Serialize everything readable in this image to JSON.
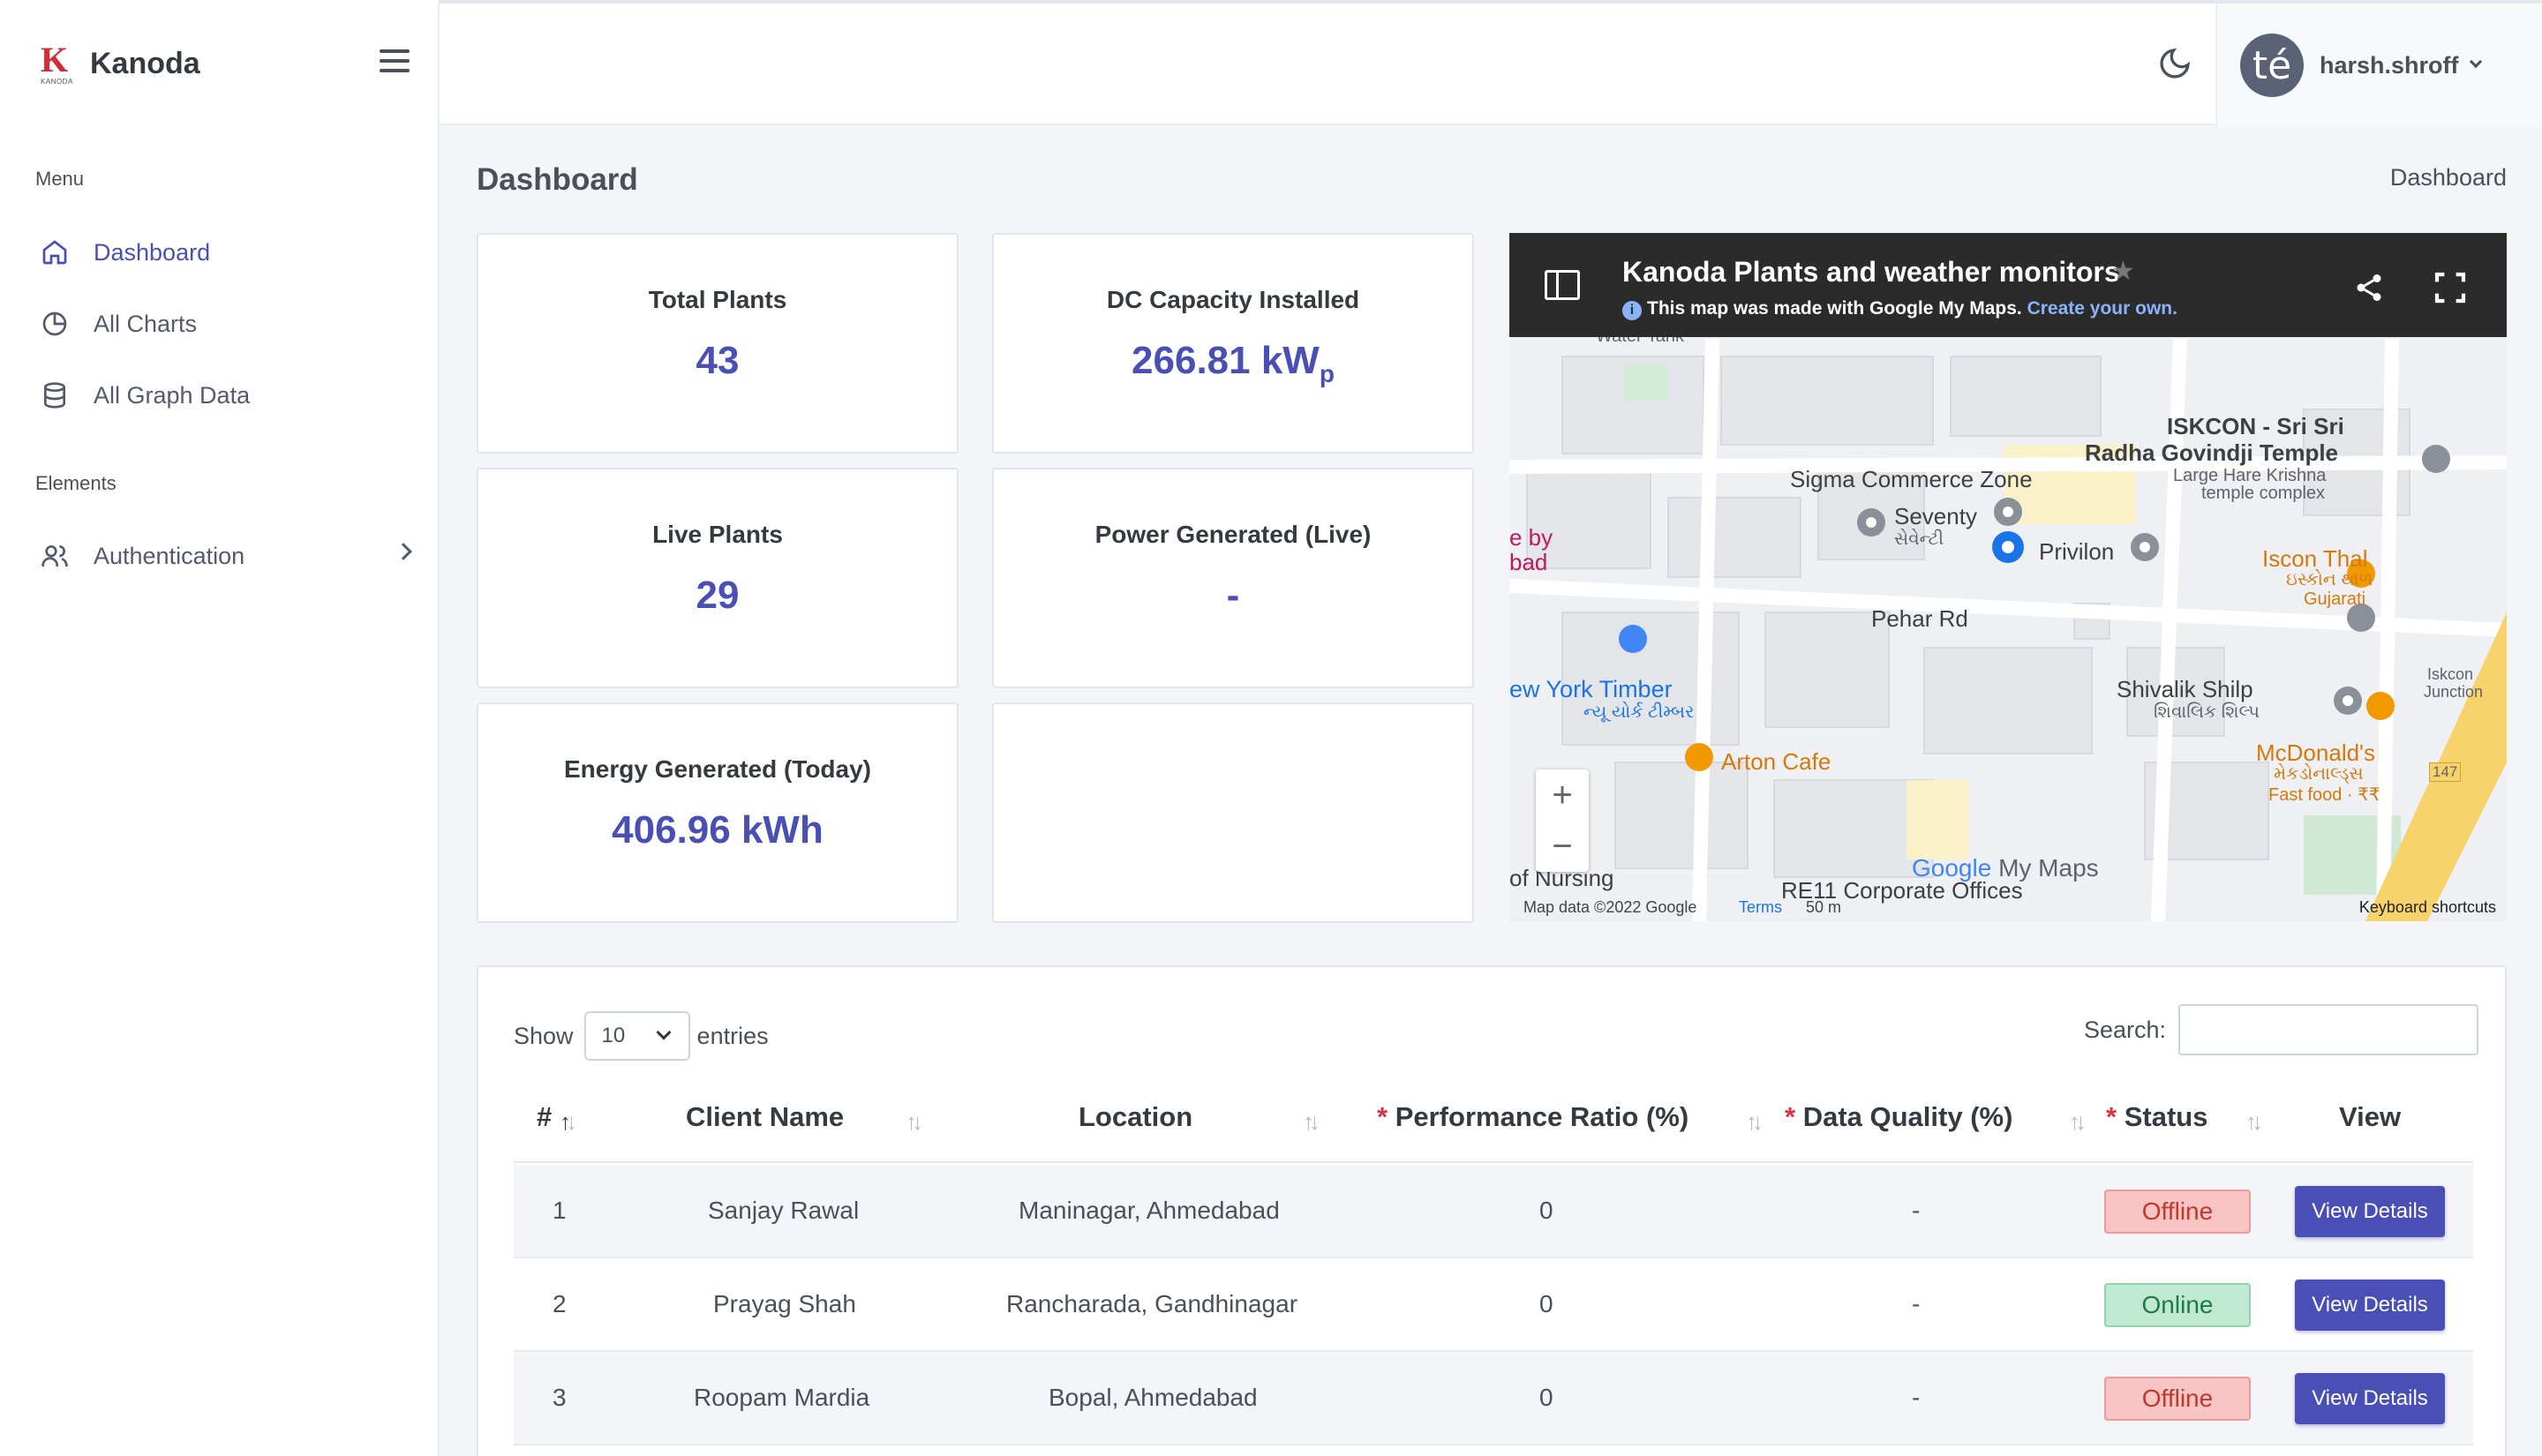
{
  "brand": {
    "name": "Kanoda",
    "logo_letter": "K",
    "logo_text": "KANODA"
  },
  "sidebar": {
    "menu_title": "Menu",
    "elements_title": "Elements",
    "items": [
      {
        "label": "Dashboard",
        "icon": "home-icon",
        "active": true
      },
      {
        "label": "All Charts",
        "icon": "pie-chart-icon"
      },
      {
        "label": "All Graph Data",
        "icon": "database-icon"
      }
    ],
    "elements": [
      {
        "label": "Authentication",
        "icon": "users-icon"
      }
    ]
  },
  "topbar": {
    "user_initials": "té",
    "user_name": "harsh.shroff",
    "theme_icon": "moon-icon"
  },
  "page": {
    "title": "Dashboard",
    "breadcrumb": "Dashboard"
  },
  "stats": {
    "total_plants": {
      "label": "Total Plants",
      "value": "43"
    },
    "dc_capacity": {
      "label": "DC Capacity Installed",
      "value": "266.81 kW",
      "unit_sub": "p"
    },
    "live_plants": {
      "label": "Live Plants",
      "value": "29"
    },
    "power_generated": {
      "label": "Power Generated (Live)",
      "value": "-"
    },
    "energy_today": {
      "label": "Energy Generated (Today)",
      "value": "406.96 kWh"
    }
  },
  "map": {
    "title": "Kanoda Plants and weather monitors",
    "subtitle": "This map was made with Google My Maps.",
    "subtitle_link": "Create your own.",
    "zoom_in": "+",
    "zoom_out": "−",
    "labels": {
      "water_tank": "Water Tank",
      "iskcon": "ISKCON - Sri Sri",
      "radha": "Radha Govindji Temple",
      "hare": "Large Hare Krishna",
      "temple": "temple complex",
      "sigma": "Sigma Commerce Zone",
      "seventy": "Seventy",
      "seventy_gu": "સેવેન્ટી",
      "privilon": "Privilon",
      "iscon_thal": "Iscon Thal",
      "iscon_thal_gu": "ઇસ્કોન થાળ",
      "gujarati": "Gujarati",
      "pehar": "Pehar Rd",
      "eby": "e by",
      "bad": "bad",
      "ny_timber": "ew York Timber",
      "ny_timber_gu": "ન્યૂ યોર્ક ટીમ્બર",
      "shivalik": "Shivalik Shilp",
      "shivalik_gu": "શિવાલિક શિલ્પ",
      "arton": "Arton Cafe",
      "mcd": "McDonald's",
      "mcd_gu": "મેકડોનાલ્ડ્સ",
      "fast_food": "Fast food · ₹₹",
      "iskcon_jn": "Iskcon",
      "junction": "Junction",
      "road_147": "147",
      "nursing": "of Nursing",
      "re11": "RE11 Corporate Offices",
      "google": "Google",
      "my_maps": "My Maps"
    },
    "footer": {
      "data": "Map data ©2022 Google",
      "terms": "Terms",
      "scale": "50 m",
      "shortcuts": "Keyboard shortcuts"
    }
  },
  "table": {
    "show_label": "Show",
    "entries_label": "entries",
    "page_size": "10",
    "search_label": "Search:",
    "headers": [
      "#",
      "Client Name",
      "Location",
      "Performance Ratio (%)",
      "Data Quality (%)",
      "Status",
      "View"
    ],
    "rows": [
      {
        "num": "1",
        "client": "Sanjay Rawal",
        "location": "Maninagar, Ahmedabad",
        "pr": "0",
        "dq": "-",
        "status": "Offline",
        "view": "View Details"
      },
      {
        "num": "2",
        "client": "Prayag Shah",
        "location": "Rancharada, Gandhinagar",
        "pr": "0",
        "dq": "-",
        "status": "Online",
        "view": "View Details"
      },
      {
        "num": "3",
        "client": "Roopam Mardia",
        "location": "Bopal, Ahmedabad",
        "pr": "0",
        "dq": "-",
        "status": "Offline",
        "view": "View Details"
      }
    ]
  },
  "colors": {
    "accent": "#4a4fb6",
    "danger": "#e0313e",
    "sidebar_bg": "#ffffff",
    "page_bg": "#f4f5f8"
  }
}
